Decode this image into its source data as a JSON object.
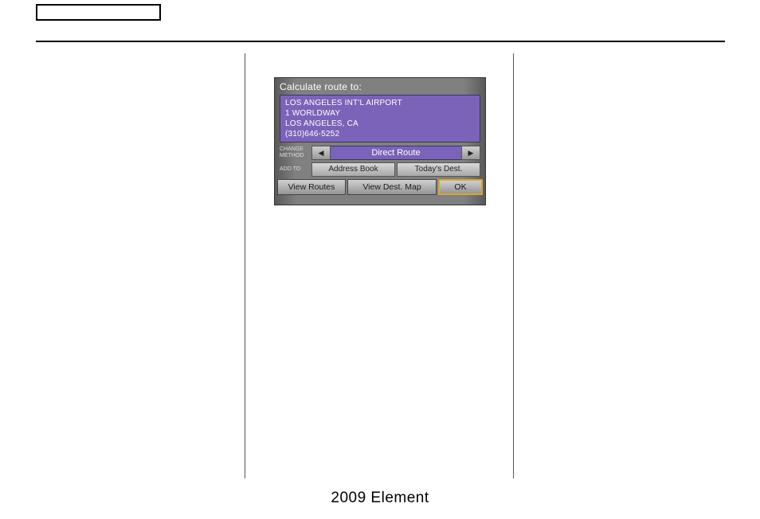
{
  "footer": "2009  Element",
  "nav": {
    "title": "Calculate route to:",
    "destination": {
      "name": "LOS ANGELES INT'L AIRPORT",
      "street": "1 WORLDWAY",
      "city": "LOS ANGELES, CA",
      "phone": "(310)646-5252"
    },
    "labels": {
      "change_method_line1": "CHANGE",
      "change_method_line2": "METHOD",
      "add_to": "ADD TO"
    },
    "method": "Direct Route",
    "arrows": {
      "left": "◀",
      "right": "▶"
    },
    "addto": {
      "address_book": "Address Book",
      "todays_dest": "Today's Dest."
    },
    "bottom": {
      "view_routes": "View Routes",
      "view_dest_map": "View Dest. Map",
      "ok": "OK"
    }
  }
}
